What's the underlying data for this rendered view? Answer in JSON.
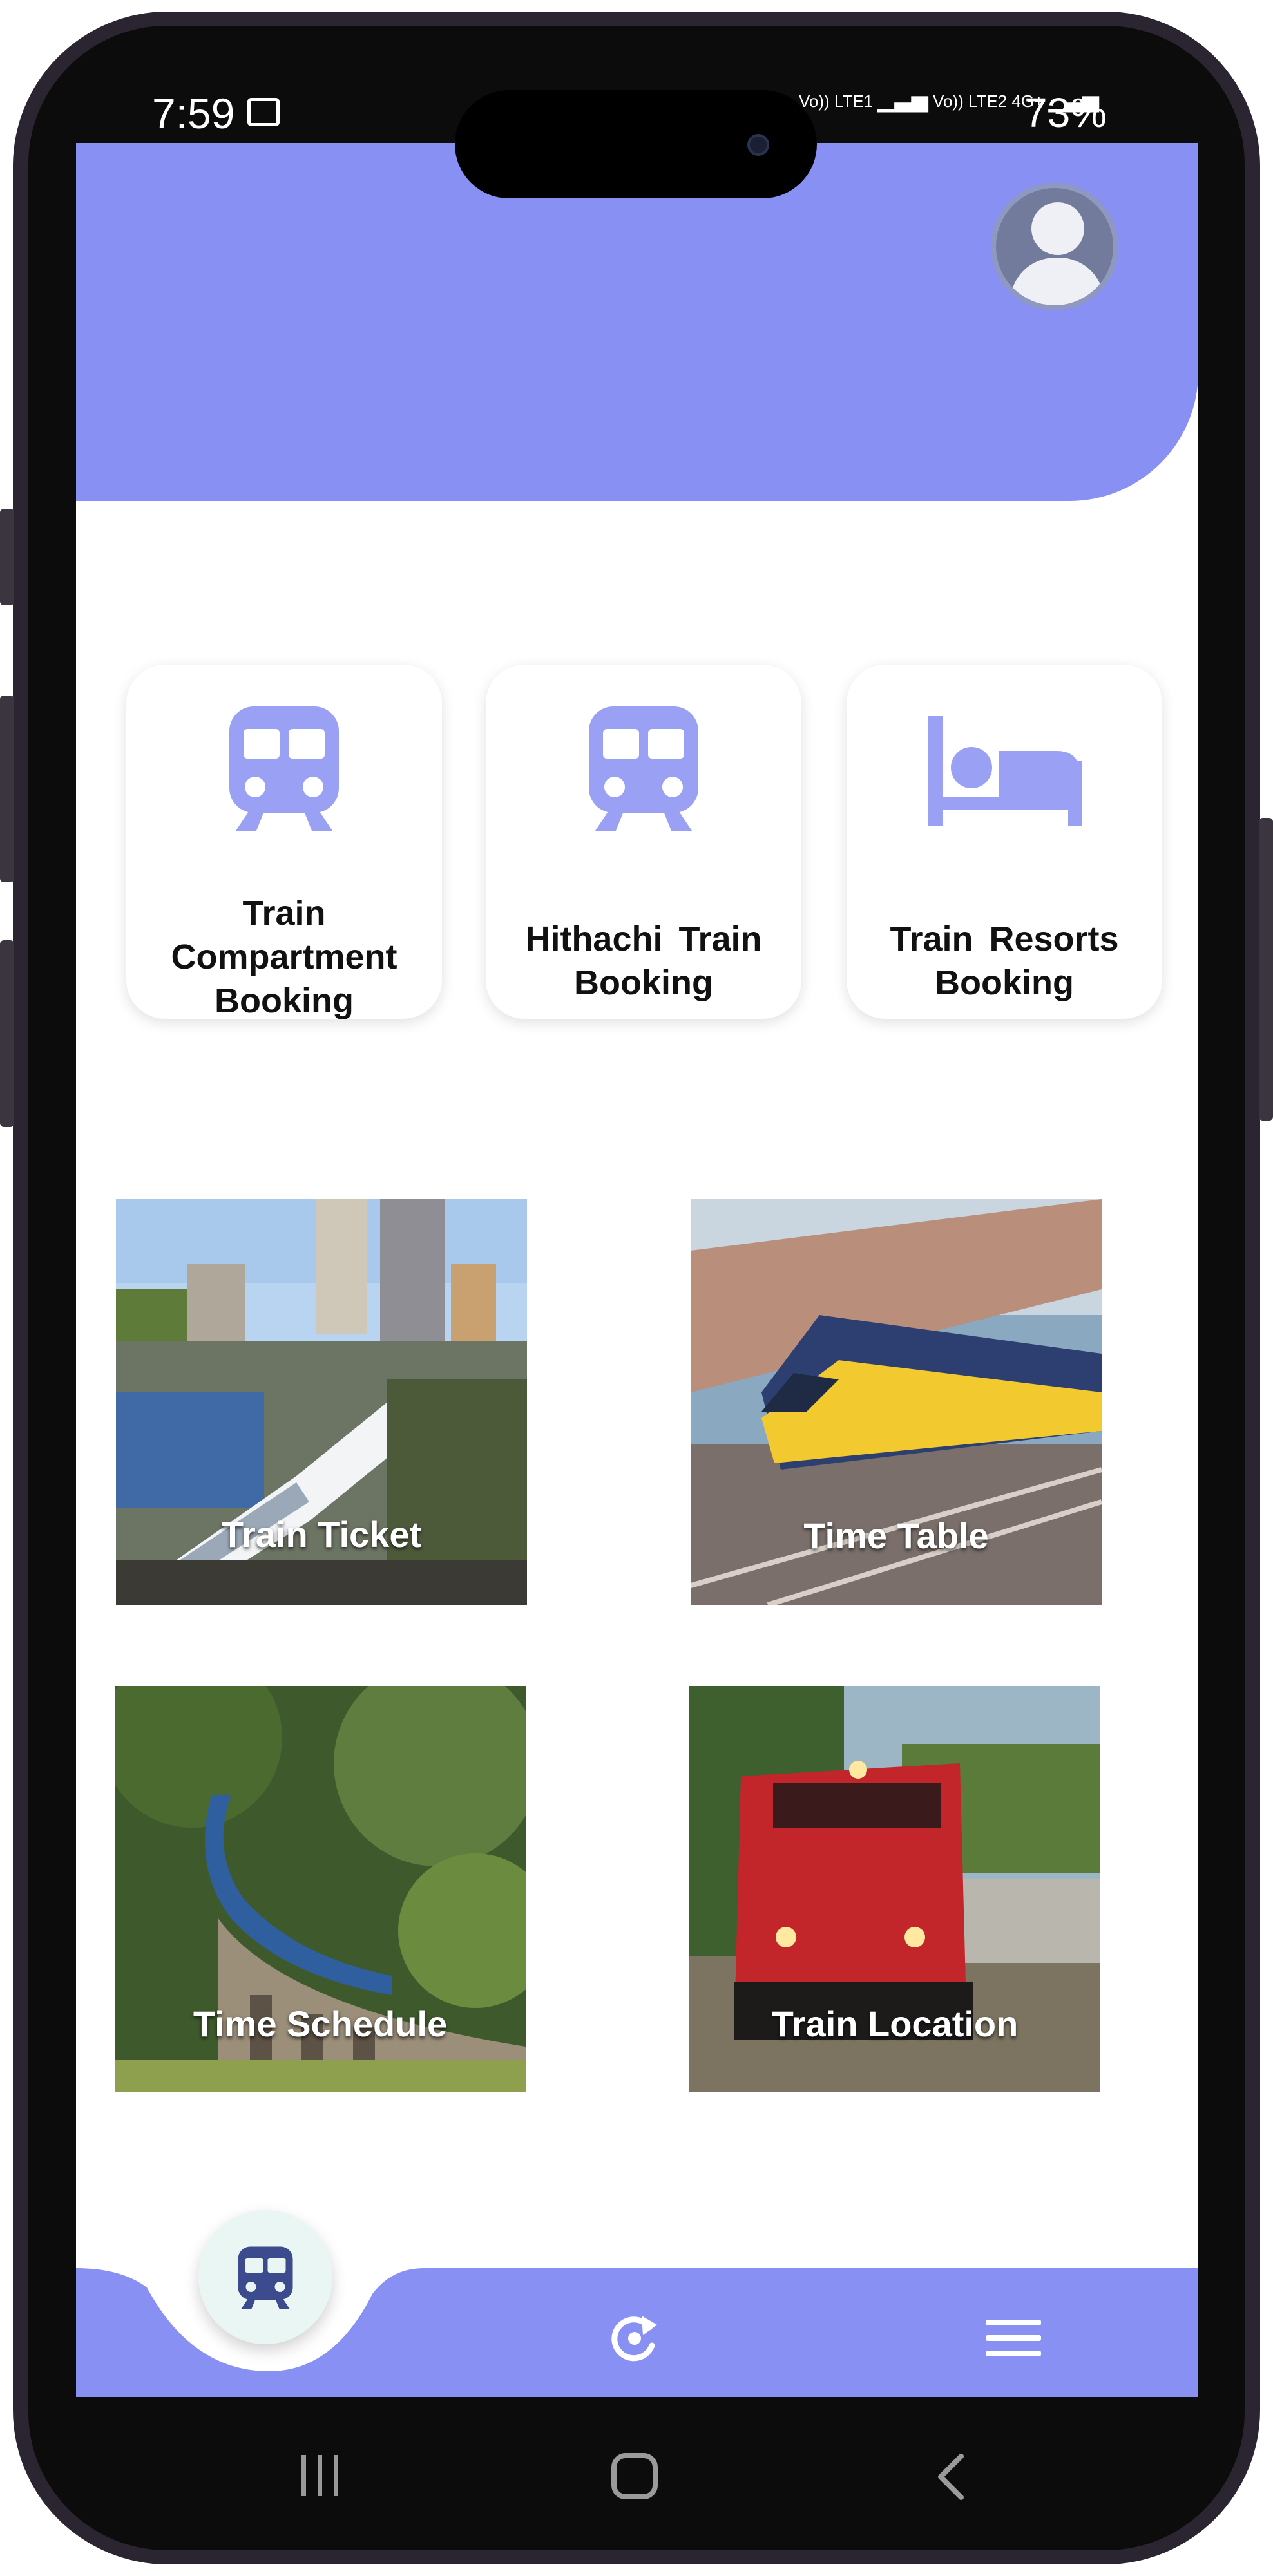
{
  "status_bar": {
    "time": "7:59",
    "network_1": "Vo)) LTE1",
    "network_2": "Vo)) LTE2",
    "data_type": "4G+",
    "battery": "73%"
  },
  "header": {
    "avatar_icon": "user-avatar-icon",
    "color": "#8891f3"
  },
  "services": [
    {
      "label_lines": [
        "Train",
        "Compartment",
        "Booking"
      ],
      "icon": "train-icon"
    },
    {
      "label_lines": [
        "Hithachi Train",
        "Booking"
      ],
      "icon": "train-icon"
    },
    {
      "label_lines": [
        "Train Resorts",
        "Booking"
      ],
      "icon": "bed-icon"
    }
  ],
  "tiles": [
    {
      "label": "Train Ticket",
      "image": "high-speed-train-photo"
    },
    {
      "label": "Time Table",
      "image": "yellow-train-motion-photo"
    },
    {
      "label": "Time Schedule",
      "image": "train-on-viaduct-photo"
    },
    {
      "label": "Train Location",
      "image": "red-locomotive-photo"
    }
  ],
  "bottom_nav": {
    "items": [
      "train-icon",
      "refresh-icon",
      "menu-icon"
    ],
    "color": "#8891f3",
    "active_bg": "#eaf6f3"
  },
  "accent_icon_color": "#9aa1f5"
}
